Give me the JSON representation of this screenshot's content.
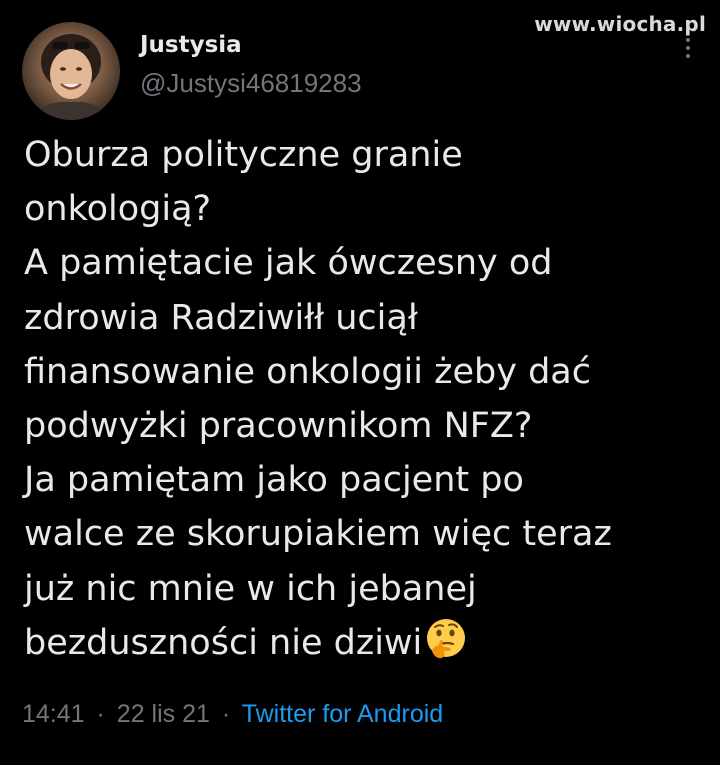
{
  "watermark": "www.wiocha.pl",
  "author": {
    "display_name": "Justysia",
    "handle": "@Justysi46819283"
  },
  "tweet": {
    "lines": [
      "Oburza polityczne granie",
      "onkologią?",
      "A pamiętacie jak ówczesny od",
      "zdrowia Radziwiłł uciął",
      "finansowanie onkologii żeby dać",
      "podwyżki pracownikom NFZ?",
      "Ja pamiętam jako pacjent po",
      "walce ze skorupiakiem więc teraz",
      "już nic mnie w ich jebanej",
      "bezduszności nie dziwi"
    ],
    "trailing_emoji": "thinking-face-icon"
  },
  "meta": {
    "time": "14:41",
    "separator": "·",
    "date": "22 lis 21",
    "source": "Twitter for Android"
  },
  "colors": {
    "background": "#000000",
    "text": "#e7e9ea",
    "secondary": "#71767b",
    "link": "#1d9bf0"
  }
}
